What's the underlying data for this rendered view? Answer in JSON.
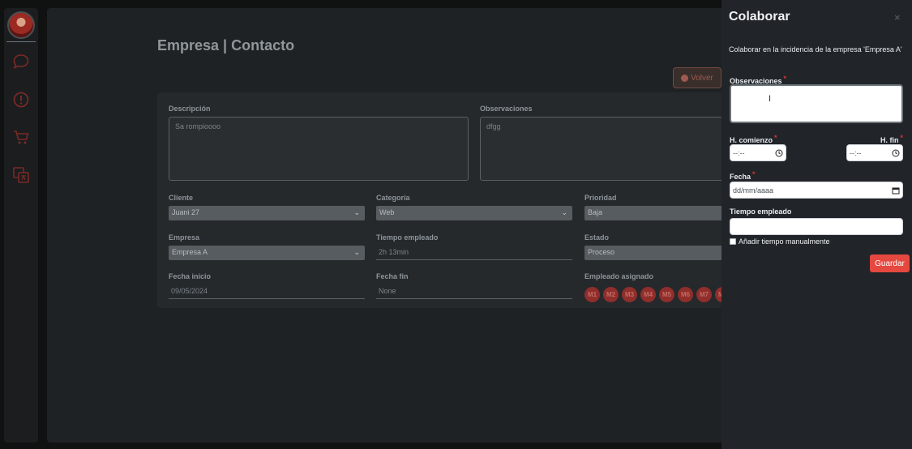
{
  "sidebar": {
    "icons": [
      "chat-icon",
      "alert-icon",
      "cart-icon",
      "translate-icon"
    ]
  },
  "header": {
    "title": "Empresa | Contacto",
    "back_label": "Volver"
  },
  "form": {
    "descripcion": {
      "label": "Descripción",
      "value": "Sa rompioooo"
    },
    "observaciones": {
      "label": "Observaciones",
      "value": "dfgg"
    },
    "cliente": {
      "label": "Cliente",
      "value": "Juani 27"
    },
    "categoria": {
      "label": "Categoría",
      "value": "Web"
    },
    "prioridad": {
      "label": "Prioridad",
      "value": "Baja"
    },
    "empresa": {
      "label": "Empresa",
      "value": "Empresa A"
    },
    "tiempo": {
      "label": "Tiempo empleado",
      "value": "2h 13min"
    },
    "estado": {
      "label": "Estado",
      "value": "Proceso"
    },
    "fecha_inicio": {
      "label": "Fecha inicio",
      "value": "09/05/2024"
    },
    "fecha_fin": {
      "label": "Fecha fin",
      "value": "None"
    },
    "empleado": {
      "label": "Empleado asignado",
      "values": [
        "M1",
        "M2",
        "M3",
        "M4",
        "M5",
        "M6",
        "M7",
        "M"
      ]
    }
  },
  "panel": {
    "title": "Colaborar",
    "close": "×",
    "description": "Colaborar en la incidencia de la empresa 'Empresa A'",
    "observaciones_label": "Observaciones",
    "h_comienzo_label": "H. comienzo",
    "h_fin_label": "H. fin",
    "time_placeholder": "--:--",
    "fecha_label": "Fecha",
    "fecha_placeholder": "dd/mm/aaaa",
    "tiempo_label": "Tiempo empleado",
    "checkbox_label": "Añadir tiempo manualmente",
    "save_label": "Guardar",
    "required_mark": "*"
  },
  "colors": {
    "accent": "#e5483f",
    "panel_bg": "#212529",
    "page_bg": "#101111"
  }
}
